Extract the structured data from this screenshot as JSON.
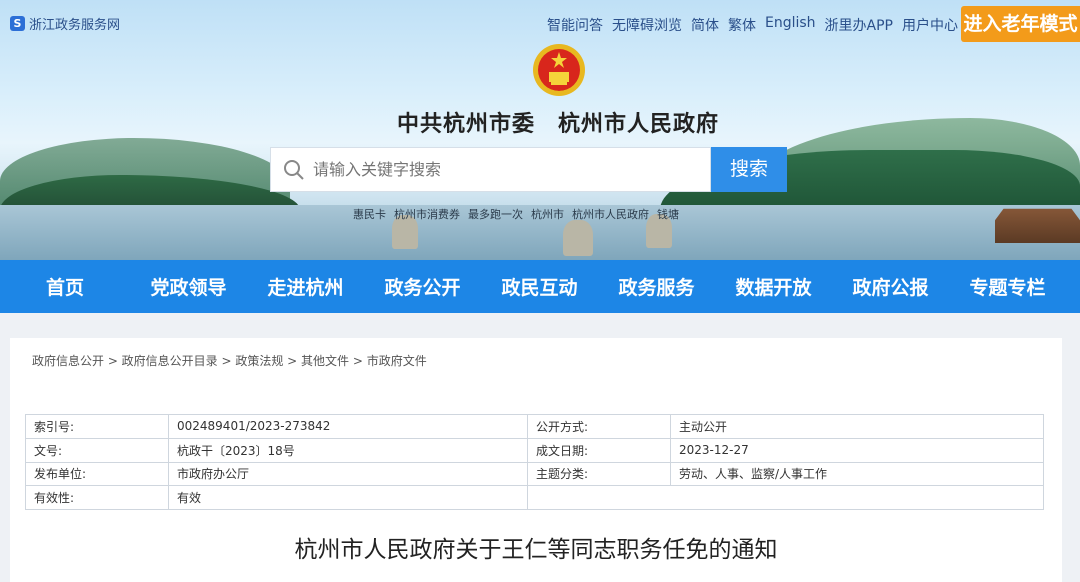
{
  "header": {
    "site_name": "浙江政务服务网",
    "top_links": [
      "智能问答",
      "无障碍浏览",
      "简体",
      "繁体",
      "English",
      "浙里办APP",
      "用户中心"
    ],
    "elder_mode": "进入老年模式",
    "gov_title": "中共杭州市委　杭州市人民政府",
    "search_placeholder": "请输入关键字搜索",
    "search_button": "搜索",
    "hot_words": [
      "惠民卡",
      "杭州市消费券",
      "最多跑一次",
      "杭州市",
      "杭州市人民政府",
      "钱塘"
    ]
  },
  "nav": [
    "首页",
    "党政领导",
    "走进杭州",
    "政务公开",
    "政民互动",
    "政务服务",
    "数据开放",
    "政府公报",
    "专题专栏"
  ],
  "breadcrumb": "政府信息公开 > 政府信息公开目录 > 政策法规 > 其他文件 > 市政府文件",
  "meta": {
    "index_label": "索引号:",
    "index_value": "002489401/2023-273842",
    "open_label": "公开方式:",
    "open_value": "主动公开",
    "doc_label": "文号:",
    "doc_value": "杭政干〔2023〕18号",
    "date_label": "成文日期:",
    "date_value": "2023-12-27",
    "issuer_label": "发布单位:",
    "issuer_value": "市政府办公厅",
    "topic_label": "主题分类:",
    "topic_value": "劳动、人事、监察/人事工作",
    "valid_label": "有效性:",
    "valid_value": "有效"
  },
  "doc_title": "杭州市人民政府关于王仁等同志职务任免的通知"
}
